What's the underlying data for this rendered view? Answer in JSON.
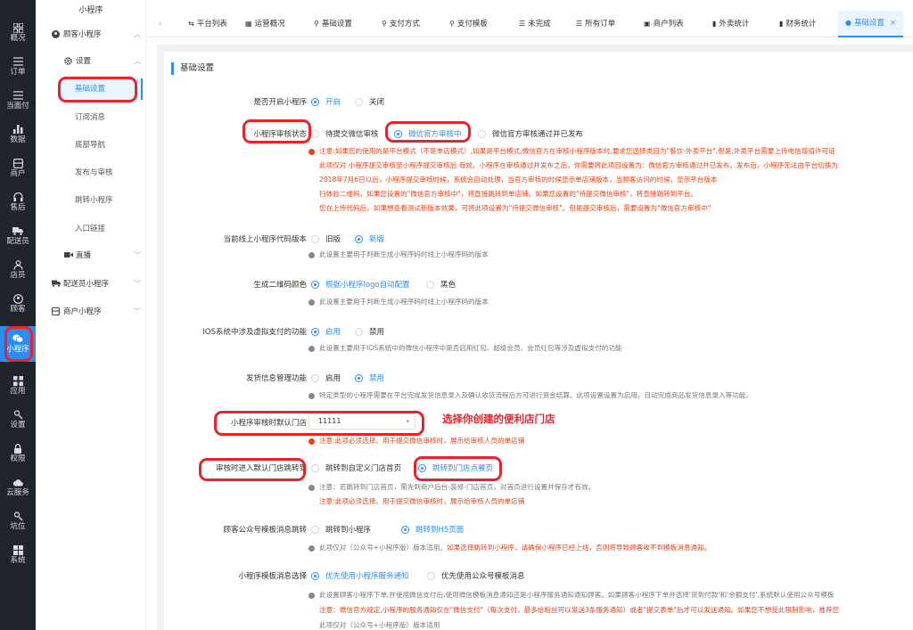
{
  "leftnav": [
    {
      "label": "概况",
      "icon": "grid-icon"
    },
    {
      "label": "订单",
      "icon": "list-icon"
    },
    {
      "label": "当面付",
      "icon": "list-icon"
    },
    {
      "label": "数据",
      "icon": "bar-chart-icon"
    },
    {
      "label": "商户",
      "icon": "store-icon"
    },
    {
      "label": "售后",
      "icon": "headset-icon"
    },
    {
      "label": "配送员",
      "icon": "truck-icon"
    },
    {
      "label": "店员",
      "icon": "users-icon"
    },
    {
      "label": "顾客",
      "icon": "user-circle-icon"
    },
    {
      "label": "小程序",
      "icon": "mini-program-icon"
    },
    {
      "label": "应用",
      "icon": "apps-icon"
    },
    {
      "label": "设置",
      "icon": "settings-icon"
    },
    {
      "label": "权限",
      "icon": "lock-icon"
    },
    {
      "label": "云服务",
      "icon": "cloud-icon"
    },
    {
      "label": "坑位",
      "icon": "slot-icon"
    },
    {
      "label": "系统",
      "icon": "windows-icon"
    }
  ],
  "subnav": {
    "title": "小程序",
    "group_customer": "顾客小程序",
    "group_settings": "设置",
    "leaves": [
      "基础设置",
      "订阅消息",
      "底部导航",
      "发布与审核",
      "跳转小程序",
      "入口链接"
    ],
    "group_live": "直播",
    "group_delivery": "配送员小程序",
    "group_merchant": "商户小程序"
  },
  "tabs": [
    {
      "label": "平台列表",
      "icon": "⇆"
    },
    {
      "label": "运营概况",
      "icon": "▦"
    },
    {
      "label": "基础设置",
      "icon": "⚲"
    },
    {
      "label": "支付方式",
      "icon": "⚲"
    },
    {
      "label": "支付模板",
      "icon": "⚲"
    },
    {
      "label": "未完成",
      "icon": "☰"
    },
    {
      "label": "所有订单",
      "icon": "☰"
    },
    {
      "label": "商户列表",
      "icon": "▣"
    },
    {
      "label": "外卖统计",
      "icon": "▮"
    },
    {
      "label": "财务统计",
      "icon": "▮"
    },
    {
      "label": "基础设置",
      "icon": "●"
    }
  ],
  "tab_close": "×",
  "tabbar_prev": "‹",
  "form": {
    "section_title": "基础设置",
    "open": {
      "label": "是否开启小程序",
      "options": [
        "开启",
        "关闭"
      ],
      "selected": 0
    },
    "review_status": {
      "label": "小程序审核状态",
      "options": [
        "待提交微信审核",
        "微信官方审核中",
        "微信官方审核通过并已发布"
      ],
      "selected": 1,
      "tips": [
        "注意:如果您的使用的是平台模式（不是单店模式）,如果是平台模式,微信官方在审核小程序版本时,要求您选择类目为\"餐饮-外卖平台\",但是,外卖平台需要上传电信增值许可证",
        "此项仅对 小程序提交审核至小程序提交审核后 有效。小程序在审核通过并发布之后，你需要将此项目设置为：微信官方审核通过并已发布。发布后，小程序无法由平台切换为",
        "2018年7月6日以后，小程序提交审核时候，系统会自动处理，当官方审核的时候显示单店铺版本，当顾客访问的时候，显示平台版本",
        "扫体验二维码，如果您设置的\"微信官方审核中\"，将直接跳转到单店铺。如果您设置的\"待提交微信审核\"，将直接跳转到平台。",
        "您在上传代码后，如果想查看测试新版本效果，可将此项设置为\"待提交微信审核\"。但是提交审核后，需要设置为\"微信官方审核中\""
      ]
    },
    "code_version": {
      "label": "当前线上小程序代码版本",
      "options": [
        "旧版",
        "新版"
      ],
      "selected": 1,
      "tip": "此设置主要用于判断生成小程序码时线上小程序码的版本"
    },
    "qr_color": {
      "label": "生成二维码颜色",
      "options": [
        "根据小程序logo自动配置",
        "黑色"
      ],
      "selected": 0,
      "tip": "此设置主要用于判断生成小程序码时线上小程序码的版本"
    },
    "ios_pay": {
      "label": "IOS系统中涉及虚拟支付的功能",
      "options": [
        "启用",
        "禁用"
      ],
      "selected": 0,
      "tip": "此设置主要用于IOS系统中的微信小程序中是否启用红包、超级会员、会员红包等涉及虚拟支付的功能"
    },
    "shipping": {
      "label": "发货信息管理功能",
      "options": [
        "启用",
        "禁用"
      ],
      "selected": 1,
      "tip": "特定类型的小程序需要在平台完成发货信息录入及确认收货流程后方可进行资金结算。此项设置设置为启用，自动完成商品发货信息录入等功能。"
    },
    "default_store": {
      "label": "小程序审核时默认门店",
      "value": "11111",
      "tip": "注意:此项必须选择。用于提交微信审核时，展示给审核人员的单店铺",
      "annotation": "选择你创建的便利店门店"
    },
    "jump_target": {
      "label": "审核时进入默认门店跳转到",
      "options": [
        "跳转到自定义门店首页",
        "跳转到门店点餐页"
      ],
      "selected": 1,
      "tip1": "注意：若跳转到门店首页，需先到商户后台-装修-门店首页，对首页进行设置并保存才有效。",
      "tip2": "注意:此项必须选择。用于提交微信审核时，展示给审核人员的单店铺"
    },
    "mp_template_jump": {
      "label": "顾客公众号模板消息跳转",
      "options": [
        "跳转到小程序",
        "跳转到H5页面"
      ],
      "selected": 1,
      "tip_gray": "此项仅对（公众号+小程序版）版本适用。",
      "tip_red": "如果选择跳转到小程序，请确保小程序已经上线，否则将导致顾客收不到模板消息通知。"
    },
    "template_choice": {
      "label": "小程序模板消息选择",
      "options": [
        "优先使用小程序服务通知",
        "优先使用公众号模板消息"
      ],
      "selected": 0,
      "tip1": "此设置顾客小程序下单,并使用微信支付后,使用微信模板消息通知还是小程序服务通知通知顾客。如果顾客小程序下单并选择'货到付款'和'余额支付',系统默认使用公众号模板",
      "tip2": "注意：微信官方规定,小程序的服务通知仅在\"微信支付\"（每次支付，最多给粉丝可以发送3条服务通知）或者\"提交表单\"后才可以发送通知。如果您不想受此限制影响，推荐您",
      "tip3": "此项仅对（公众号+小程序版）版本适用"
    }
  },
  "colors": {
    "accent": "#2d8cf0",
    "highlight": "#e8232b",
    "nav_bg": "#20242b",
    "warn": "#ed4014"
  }
}
